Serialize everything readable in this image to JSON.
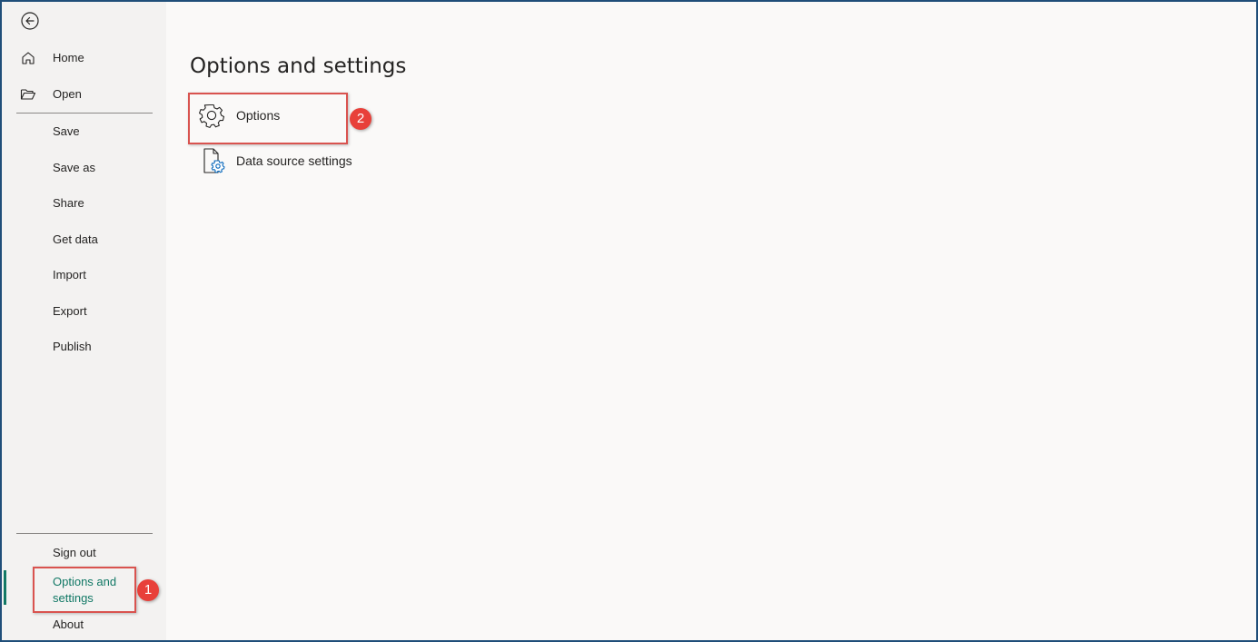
{
  "sidebar": {
    "back_icon": "arrow-left-circle-icon",
    "top_items": [
      {
        "label": "Home",
        "icon": "home-icon"
      },
      {
        "label": "Open",
        "icon": "folder-open-icon"
      }
    ],
    "items": [
      {
        "label": "Save"
      },
      {
        "label": "Save as"
      },
      {
        "label": "Share"
      },
      {
        "label": "Get data"
      },
      {
        "label": "Import"
      },
      {
        "label": "Export"
      },
      {
        "label": "Publish"
      }
    ],
    "bottom_items": [
      {
        "label": "Sign out"
      },
      {
        "label": "Options and settings",
        "active": true
      },
      {
        "label": "About"
      }
    ]
  },
  "main": {
    "title": "Options and settings",
    "options": [
      {
        "label": "Options",
        "icon": "gear-icon"
      },
      {
        "label": "Data source settings",
        "icon": "document-gear-icon"
      }
    ]
  },
  "annotations": [
    {
      "label": "1"
    },
    {
      "label": "2"
    }
  ],
  "colors": {
    "accent": "#117865",
    "annotation_red": "#e8403a",
    "frame_border": "#1f4e79"
  }
}
